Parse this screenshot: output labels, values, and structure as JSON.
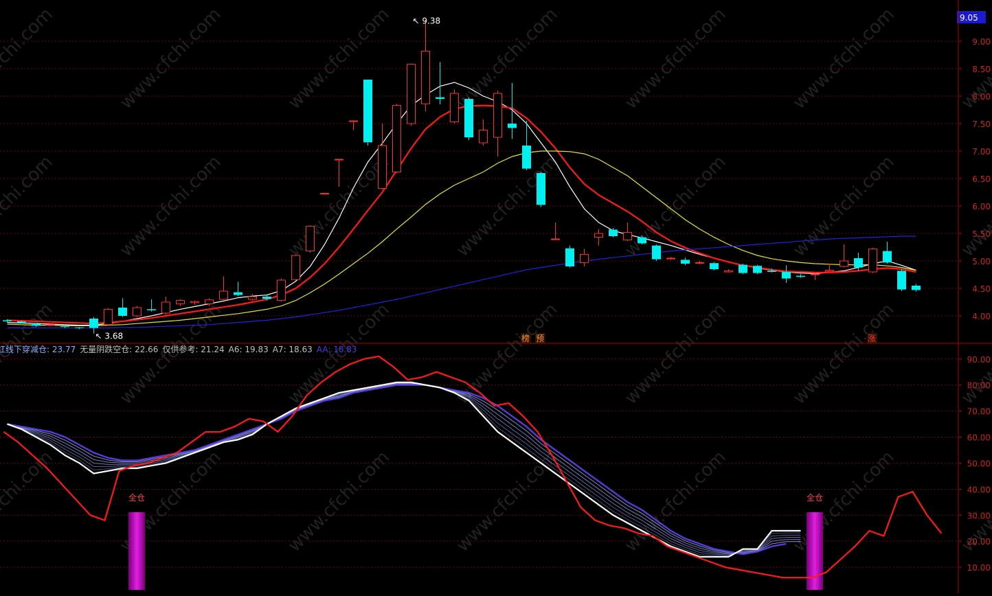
{
  "colors": {
    "background": "#000000",
    "grid": "#7a0000",
    "axis": "#b00000",
    "axis_text": "#d02020",
    "up": "#ff3030",
    "down": "#00f0f0",
    "ma_white": "#ffffff",
    "ma_red": "#ff1a1a",
    "ma_yellow": "#e6e62a",
    "ma_blue": "#2222dd",
    "price_tag_bg": "#1a1ad0",
    "fan_outer": "#5a3ad8",
    "bar_magenta": "#e21ee2",
    "signal_text": "#ff4040"
  },
  "chart_data": [
    {
      "id": "price",
      "type": "candlestick",
      "ylim": [
        3.5,
        9.75
      ],
      "y_ticks": [
        "9.00",
        "8.50",
        "8.00",
        "7.50",
        "7.00",
        "6.50",
        "6.00",
        "5.50",
        "5.00",
        "4.50",
        "4.00"
      ],
      "y_tick_values": [
        9.0,
        8.5,
        8.0,
        7.5,
        7.0,
        6.5,
        6.0,
        5.5,
        5.0,
        4.5,
        4.0
      ],
      "current_price": "9.05",
      "annotations": [
        {
          "text": "9.38",
          "bar": 28,
          "value": 9.38
        },
        {
          "text": "3.68",
          "bar": 6,
          "value": 3.68
        }
      ],
      "markers": [
        {
          "text": "榜",
          "bar": 36
        },
        {
          "text": "预",
          "bar": 37
        },
        {
          "text": "涨",
          "bar": 60
        }
      ],
      "candles": [
        [
          3.92,
          3.9,
          3.94,
          3.88
        ],
        [
          3.9,
          3.88,
          3.92,
          3.86
        ],
        [
          3.85,
          3.82,
          3.87,
          3.8
        ],
        [
          3.83,
          3.84,
          3.86,
          3.81
        ],
        [
          3.81,
          3.8,
          3.83,
          3.78
        ],
        [
          3.79,
          3.78,
          3.8,
          3.76
        ],
        [
          3.95,
          3.78,
          3.98,
          3.68
        ],
        [
          3.84,
          4.12,
          4.14,
          3.82
        ],
        [
          4.15,
          4.0,
          4.32,
          3.98
        ],
        [
          4.0,
          4.15,
          4.18,
          3.98
        ],
        [
          4.12,
          4.1,
          4.3,
          4.08
        ],
        [
          4.05,
          4.25,
          4.35,
          4.02
        ],
        [
          4.22,
          4.28,
          4.3,
          4.18
        ],
        [
          4.24,
          4.26,
          4.28,
          4.2
        ],
        [
          4.22,
          4.29,
          4.32,
          4.18
        ],
        [
          4.3,
          4.45,
          4.72,
          4.28
        ],
        [
          4.43,
          4.38,
          4.62,
          4.36
        ],
        [
          4.3,
          4.35,
          4.4,
          4.28
        ],
        [
          4.35,
          4.31,
          4.38,
          4.28
        ],
        [
          4.28,
          4.65,
          4.68,
          4.26
        ],
        [
          4.66,
          5.1,
          5.12,
          4.64
        ],
        [
          5.18,
          5.63,
          5.65,
          5.15
        ],
        [
          6.23,
          6.23,
          6.23,
          6.23
        ],
        [
          6.85,
          6.85,
          6.85,
          6.35
        ],
        [
          7.55,
          7.55,
          7.55,
          7.38
        ],
        [
          8.3,
          7.16,
          8.3,
          7.1
        ],
        [
          6.32,
          7.1,
          7.5,
          6.3
        ],
        [
          6.62,
          7.83,
          7.86,
          6.6
        ],
        [
          7.5,
          8.58,
          8.59,
          7.46
        ],
        [
          7.86,
          8.82,
          9.38,
          7.72
        ],
        [
          7.98,
          7.95,
          8.62,
          7.85
        ],
        [
          7.53,
          8.05,
          8.12,
          7.5
        ],
        [
          7.95,
          7.25,
          7.98,
          7.2
        ],
        [
          7.15,
          7.38,
          7.58,
          7.1
        ],
        [
          7.25,
          8.05,
          8.1,
          6.9
        ],
        [
          7.5,
          7.42,
          8.24,
          7.22
        ],
        [
          7.1,
          6.68,
          7.55,
          6.65
        ],
        [
          6.6,
          6.02,
          6.62,
          5.98
        ],
        [
          5.4,
          5.4,
          5.7,
          5.4
        ],
        [
          5.23,
          4.9,
          5.28,
          4.88
        ],
        [
          4.97,
          5.12,
          5.22,
          4.9
        ],
        [
          5.43,
          5.5,
          5.58,
          5.28
        ],
        [
          5.57,
          5.45,
          5.6,
          5.43
        ],
        [
          5.38,
          5.52,
          5.7,
          5.36
        ],
        [
          5.43,
          5.32,
          5.46,
          5.3
        ],
        [
          5.28,
          5.03,
          5.3,
          5.0
        ],
        [
          5.05,
          5.05,
          5.07,
          5.02
        ],
        [
          5.02,
          4.95,
          5.06,
          4.92
        ],
        [
          4.96,
          4.97,
          5.0,
          4.94
        ],
        [
          4.96,
          4.85,
          4.98,
          4.83
        ],
        [
          4.8,
          4.82,
          4.85,
          4.79
        ],
        [
          4.93,
          4.78,
          4.95,
          4.76
        ],
        [
          4.91,
          4.78,
          4.93,
          4.76
        ],
        [
          4.82,
          4.8,
          4.86,
          4.79
        ],
        [
          4.8,
          4.68,
          4.92,
          4.6
        ],
        [
          4.73,
          4.71,
          4.76,
          4.69
        ],
        [
          4.75,
          4.76,
          4.78,
          4.65
        ],
        [
          4.81,
          4.83,
          4.95,
          4.8
        ],
        [
          4.9,
          5.0,
          5.3,
          4.88
        ],
        [
          5.05,
          4.88,
          5.15,
          4.82
        ],
        [
          4.8,
          5.22,
          5.24,
          4.78
        ],
        [
          5.18,
          4.97,
          5.35,
          4.95
        ],
        [
          4.82,
          4.48,
          4.85,
          4.45
        ],
        [
          4.55,
          4.47,
          4.58,
          4.44
        ]
      ],
      "series": [
        {
          "name": "",
          "color_key": "ma_white",
          "values": [
            3.88,
            3.87,
            3.86,
            3.85,
            3.84,
            3.83,
            3.83,
            3.86,
            3.9,
            3.95,
            4.0,
            4.06,
            4.12,
            4.17,
            4.22,
            4.27,
            4.33,
            4.36,
            4.38,
            4.46,
            4.63,
            4.9,
            5.3,
            5.78,
            6.33,
            6.8,
            7.14,
            7.5,
            7.83,
            8.02,
            8.18,
            8.25,
            8.15,
            8.0,
            7.9,
            7.75,
            7.5,
            7.15,
            6.8,
            6.35,
            5.95,
            5.7,
            5.55,
            5.48,
            5.42,
            5.35,
            5.28,
            5.2,
            5.12,
            5.05,
            4.98,
            4.92,
            4.87,
            4.83,
            4.8,
            4.78,
            4.77,
            4.79,
            4.82,
            4.88,
            4.95,
            5.0,
            4.92,
            4.83
          ]
        },
        {
          "name": "",
          "color_key": "ma_red",
          "values": [
            3.92,
            3.91,
            3.9,
            3.89,
            3.88,
            3.87,
            3.86,
            3.88,
            3.9,
            3.93,
            3.96,
            4.0,
            4.04,
            4.08,
            4.12,
            4.16,
            4.2,
            4.25,
            4.3,
            4.38,
            4.5,
            4.7,
            4.95,
            5.25,
            5.58,
            5.92,
            6.25,
            6.65,
            7.05,
            7.4,
            7.62,
            7.77,
            7.82,
            7.83,
            7.82,
            7.78,
            7.6,
            7.35,
            7.05,
            6.7,
            6.4,
            6.2,
            6.05,
            5.9,
            5.72,
            5.52,
            5.36,
            5.24,
            5.14,
            5.05,
            4.98,
            4.92,
            4.88,
            4.84,
            4.81,
            4.8,
            4.79,
            4.79,
            4.8,
            4.82,
            4.85,
            4.87,
            4.85,
            4.8
          ]
        },
        {
          "name": "",
          "color_key": "ma_yellow",
          "values": [
            3.85,
            3.84,
            3.83,
            3.83,
            3.82,
            3.82,
            3.82,
            3.83,
            3.84,
            3.86,
            3.88,
            3.9,
            3.92,
            3.95,
            3.98,
            4.01,
            4.04,
            4.08,
            4.12,
            4.18,
            4.28,
            4.42,
            4.58,
            4.76,
            4.95,
            5.14,
            5.35,
            5.58,
            5.8,
            6.03,
            6.22,
            6.38,
            6.5,
            6.62,
            6.78,
            6.9,
            6.97,
            7.0,
            7.0,
            6.99,
            6.95,
            6.85,
            6.7,
            6.55,
            6.35,
            6.15,
            5.95,
            5.75,
            5.58,
            5.43,
            5.3,
            5.19,
            5.1,
            5.04,
            5.0,
            4.97,
            4.95,
            4.94,
            4.93,
            4.93,
            4.93,
            4.91,
            4.88,
            4.83
          ]
        },
        {
          "name": "",
          "color_key": "ma_blue",
          "values": [
            3.78,
            3.78,
            3.78,
            3.78,
            3.78,
            3.78,
            3.78,
            3.78,
            3.79,
            3.79,
            3.8,
            3.81,
            3.82,
            3.83,
            3.84,
            3.86,
            3.88,
            3.9,
            3.92,
            3.95,
            3.98,
            4.02,
            4.06,
            4.1,
            4.15,
            4.2,
            4.25,
            4.3,
            4.36,
            4.42,
            4.48,
            4.54,
            4.6,
            4.66,
            4.72,
            4.78,
            4.84,
            4.88,
            4.92,
            4.96,
            5.0,
            5.03,
            5.06,
            5.09,
            5.12,
            5.15,
            5.18,
            5.2,
            5.22,
            5.24,
            5.26,
            5.28,
            5.3,
            5.32,
            5.34,
            5.36,
            5.38,
            5.4,
            5.41,
            5.42,
            5.43,
            5.44,
            5.45,
            5.45
          ]
        }
      ]
    },
    {
      "id": "oscillator",
      "type": "line",
      "ylim": [
        0,
        96
      ],
      "y_ticks": [
        "90.00",
        "80.00",
        "70.00",
        "60.00",
        "50.00",
        "40.00",
        "30.00",
        "20.00",
        "10.00"
      ],
      "y_tick_values": [
        90,
        80,
        70,
        60,
        50,
        40,
        30,
        20,
        10
      ],
      "legend": [
        {
          "label": "红线下穿减仓: 23.77",
          "color": "#8ab0ff"
        },
        {
          "label": "无量阴跌空仓: 22.66",
          "color": "#c0c0c0"
        },
        {
          "label": "仅供参考: 21.24",
          "color": "#c0c0c0"
        },
        {
          "label": "A6: 19.83",
          "color": "#c0c0c0"
        },
        {
          "label": "A7: 18.63",
          "color": "#c0c0c0"
        },
        {
          "label": "AA: 18.83",
          "color": "#4a3ae0"
        }
      ],
      "red_line": [
        62,
        58,
        53,
        48,
        42,
        36,
        30,
        28,
        47,
        49,
        50,
        52,
        54,
        58,
        62,
        62,
        64,
        67,
        66,
        62,
        68,
        76,
        81,
        85,
        88,
        90,
        91,
        87,
        82,
        83,
        85,
        83,
        81,
        77,
        72,
        73,
        68,
        62,
        53,
        43,
        33,
        28,
        26,
        25,
        23,
        22,
        18,
        16,
        14,
        12,
        10,
        9,
        8,
        7,
        6,
        6,
        6,
        8,
        13,
        18,
        24,
        22,
        37,
        39,
        30,
        23
      ],
      "white_line": [
        65,
        63,
        60,
        57,
        53,
        50,
        46,
        47,
        48,
        48,
        49,
        50,
        52,
        54,
        56,
        58,
        59,
        61,
        65,
        68,
        71,
        73,
        75,
        77,
        78,
        79,
        80,
        81,
        81,
        80,
        79,
        77,
        74,
        68,
        62,
        58,
        54,
        50,
        46,
        42,
        38,
        34,
        30,
        27,
        24,
        21,
        18,
        16,
        14,
        14,
        14,
        17,
        17,
        24,
        24,
        24
      ],
      "outer_line": [
        65,
        64,
        63,
        62,
        60,
        57,
        54,
        52,
        51,
        51,
        52,
        53,
        54,
        55,
        57,
        59,
        61,
        63,
        65,
        67,
        70,
        72,
        74,
        75,
        77,
        78,
        79,
        80,
        80,
        80,
        79,
        78,
        77,
        75,
        72,
        68,
        64,
        59,
        55,
        51,
        47,
        43,
        39,
        35,
        32,
        28,
        24,
        21,
        19,
        17,
        16,
        15,
        16,
        18,
        19
      ],
      "signals": [
        {
          "text": "全仓",
          "bar": 9
        },
        {
          "text": "全仓",
          "bar": 56
        }
      ]
    }
  ]
}
